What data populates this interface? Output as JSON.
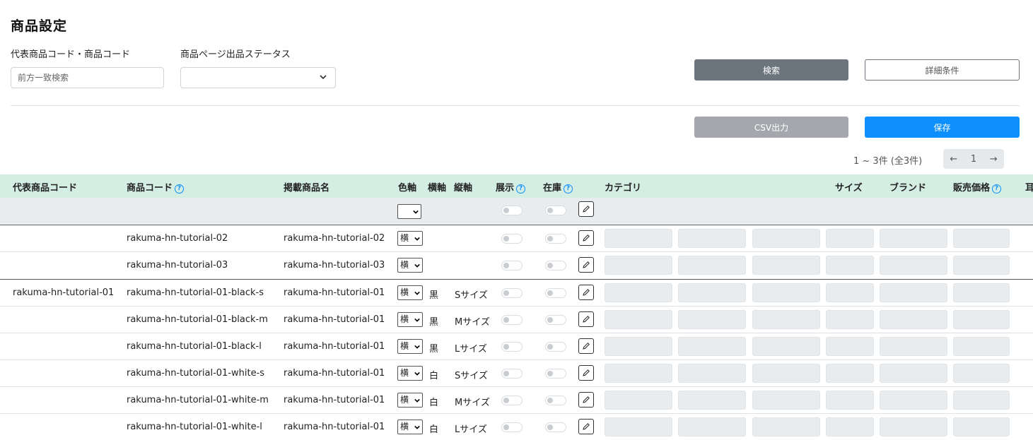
{
  "page": {
    "title": "商品設定"
  },
  "search": {
    "code_label": "代表商品コード・商品コード",
    "code_placeholder": "前方一致検索",
    "status_label": "商品ページ出品ステータス",
    "status_value": "",
    "search_button": "検索",
    "detail_button": "詳細条件"
  },
  "actions": {
    "csv_button": "CSV出力",
    "save_button": "保存"
  },
  "pagination": {
    "summary": "1 ~ 3件 (全3件)",
    "prev": "←",
    "page": "1",
    "next": "→"
  },
  "table": {
    "headers": {
      "rep_code": "代表商品コード",
      "code": "商品コード",
      "name": "掲載商品名",
      "color_axis": "色軸",
      "h_axis": "横軸",
      "v_axis": "縦軸",
      "display": "展示",
      "stock": "在庫",
      "category": "カテゴリ",
      "size": "サイズ",
      "brand": "ブランド",
      "price": "販売価格",
      "trailing": "耳"
    },
    "filter": {
      "axis_value": ""
    },
    "rows": [
      {
        "rep": "",
        "code": "rakuma-hn-tutorial-02",
        "name": "rakuma-hn-tutorial-02",
        "axis": "横",
        "h": "",
        "v": ""
      },
      {
        "rep": "",
        "code": "rakuma-hn-tutorial-03",
        "name": "rakuma-hn-tutorial-03",
        "axis": "横",
        "h": "",
        "v": ""
      },
      {
        "rep": "rakuma-hn-tutorial-01",
        "code": "rakuma-hn-tutorial-01-black-s",
        "name": "rakuma-hn-tutorial-01",
        "axis": "横",
        "h": "黒",
        "v": "Sサイズ"
      },
      {
        "rep": "",
        "code": "rakuma-hn-tutorial-01-black-m",
        "name": "rakuma-hn-tutorial-01",
        "axis": "横",
        "h": "黒",
        "v": "Mサイズ"
      },
      {
        "rep": "",
        "code": "rakuma-hn-tutorial-01-black-l",
        "name": "rakuma-hn-tutorial-01",
        "axis": "横",
        "h": "黒",
        "v": "Lサイズ"
      },
      {
        "rep": "",
        "code": "rakuma-hn-tutorial-01-white-s",
        "name": "rakuma-hn-tutorial-01",
        "axis": "横",
        "h": "白",
        "v": "Sサイズ"
      },
      {
        "rep": "",
        "code": "rakuma-hn-tutorial-01-white-m",
        "name": "rakuma-hn-tutorial-01",
        "axis": "横",
        "h": "白",
        "v": "Mサイズ"
      },
      {
        "rep": "",
        "code": "rakuma-hn-tutorial-01-white-l",
        "name": "rakuma-hn-tutorial-01",
        "axis": "横",
        "h": "白",
        "v": "Lサイズ"
      }
    ]
  },
  "icons": {
    "help": "question-circle-icon",
    "edit": "pencil-icon",
    "dropdown": "chevron-down-icon",
    "help_glyph": "?"
  },
  "colors": {
    "header_bg": "#d5eee3",
    "primary": "#0d8ffd",
    "secondary": "#6c757d"
  }
}
